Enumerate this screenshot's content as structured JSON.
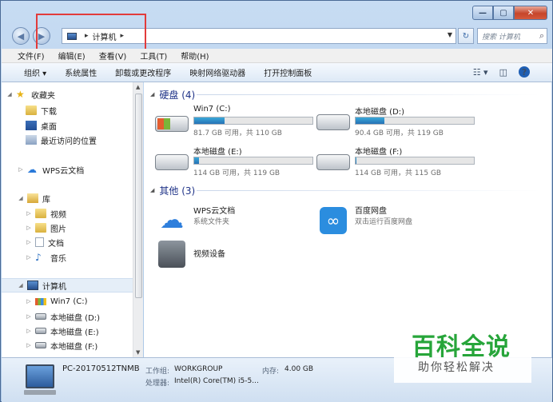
{
  "title_bar": {
    "min": "—",
    "max": "▢",
    "close": "✕"
  },
  "nav": {
    "back": "◀",
    "forward": "▶",
    "address_root_sep": "▸",
    "address_crumb": "计算机",
    "address_sep2": "▸",
    "refresh": "↻",
    "search_placeholder": "搜索 计算机",
    "search_icon": "search-icon"
  },
  "menu": [
    "文件(F)",
    "编辑(E)",
    "查看(V)",
    "工具(T)",
    "帮助(H)"
  ],
  "toolbar": [
    "组织 ▾",
    "系统属性",
    "卸载或更改程序",
    "映射网络驱动器",
    "打开控制面板"
  ],
  "sidebar": {
    "favorites": "收藏夹",
    "favorites_items": [
      "下载",
      "桌面",
      "最近访问的位置"
    ],
    "wps": "WPS云文档",
    "libraries": "库",
    "library_items": [
      "视频",
      "图片",
      "文档",
      "音乐"
    ],
    "computer": "计算机",
    "computer_items": [
      "Win7 (C:)",
      "本地磁盘 (D:)",
      "本地磁盘 (E:)",
      "本地磁盘 (F:)"
    ]
  },
  "content": {
    "disks_header": "硬盘 (4)",
    "disks": [
      {
        "name": "Win7 (C:)",
        "info": "81.7 GB 可用，共 110 GB",
        "used_fraction": 0.26
      },
      {
        "name": "本地磁盘 (D:)",
        "info": "90.4 GB 可用，共 119 GB",
        "used_fraction": 0.24
      },
      {
        "name": "本地磁盘 (E:)",
        "info": "114 GB 可用，共 119 GB",
        "used_fraction": 0.04
      },
      {
        "name": "本地磁盘 (F:)",
        "info": "114 GB 可用，共 115 GB",
        "used_fraction": 0.01
      }
    ],
    "other_header": "其他 (3)",
    "others": [
      {
        "name": "WPS云文档",
        "desc": "系统文件夹"
      },
      {
        "name": "百度网盘",
        "desc": "双击运行百度网盘"
      },
      {
        "name": "视频设备",
        "desc": ""
      }
    ]
  },
  "details": {
    "pc_name": "PC-20170512TNMB",
    "workgroup_label": "工作组:",
    "workgroup": "WORKGROUP",
    "memory_label": "内存:",
    "memory": "4.00 GB",
    "cpu_label": "处理器:",
    "cpu": "Intel(R) Core(TM) i5-5..."
  },
  "watermark": {
    "title": "百科全说",
    "subtitle": "助你轻松解决"
  },
  "colors": {
    "accent": "#1e3287",
    "annotation": "#e23b3b",
    "watermark_green": "#27a53a"
  }
}
